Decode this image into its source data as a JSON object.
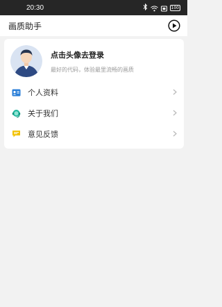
{
  "status_bar": {
    "time": "20:30",
    "bluetooth_icon": "bluetooth-icon",
    "wifi_icon": "wifi-icon",
    "sim_icon": "sim-icon",
    "battery_level": "100"
  },
  "app_bar": {
    "title": "画质助手",
    "play_icon": "play-circle-icon"
  },
  "profile": {
    "login_prompt": "点击头像去登录",
    "tagline": "最好的代码，体验最里流畅的画质"
  },
  "menu": {
    "items": [
      {
        "label": "个人资料",
        "icon": "id-card-icon",
        "icon_color": "#2b7fd8"
      },
      {
        "label": "关于我们",
        "icon": "headset-icon",
        "icon_color": "#1fb89e"
      },
      {
        "label": "意见反馈",
        "icon": "feedback-icon",
        "icon_color": "#f2c200"
      }
    ]
  },
  "colors": {
    "status_bar_bg": "#262626",
    "page_bg": "#f2f2f2",
    "card_bg": "#ffffff"
  }
}
